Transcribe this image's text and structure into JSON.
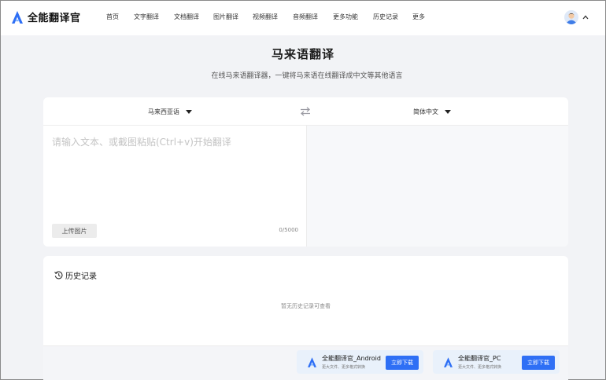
{
  "brand": {
    "name": "全能翻译官",
    "logo_icon": "brand-a-logo",
    "color": "#2e6ff5"
  },
  "nav": [
    {
      "label": "首页"
    },
    {
      "label": "文字翻译"
    },
    {
      "label": "文档翻译"
    },
    {
      "label": "图片翻译"
    },
    {
      "label": "视频翻译"
    },
    {
      "label": "音频翻译"
    },
    {
      "label": "更多功能"
    },
    {
      "label": "历史记录"
    },
    {
      "label": "更多"
    }
  ],
  "user": {
    "avatar_icon": "user-avatar-icon",
    "menu_icon": "chevron-up-icon"
  },
  "page": {
    "title": "马来语翻译",
    "subtitle": "在线马来语翻译器，一键将马来语在线翻译成中文等其他语言"
  },
  "translator": {
    "source_lang": "马来西亚语",
    "target_lang": "简体中文",
    "swap_icon": "swap-arrows-icon",
    "input_value": "",
    "input_placeholder": "请输入文本、或截图粘贴(Ctrl+v)开始翻译",
    "upload_label": "上传图片",
    "char_count": "0/5000",
    "output_value": ""
  },
  "history": {
    "icon": "history-clock-icon",
    "title": "历史记录",
    "empty_text": "暂无历史记录可查看"
  },
  "apps": [
    {
      "name": "全能翻译官_Android",
      "desc": "更大文件、更多格式转换",
      "button": "立即下载"
    },
    {
      "name": "全能翻译官_PC",
      "desc": "更大文件、更多格式转换",
      "button": "立即下载"
    }
  ]
}
